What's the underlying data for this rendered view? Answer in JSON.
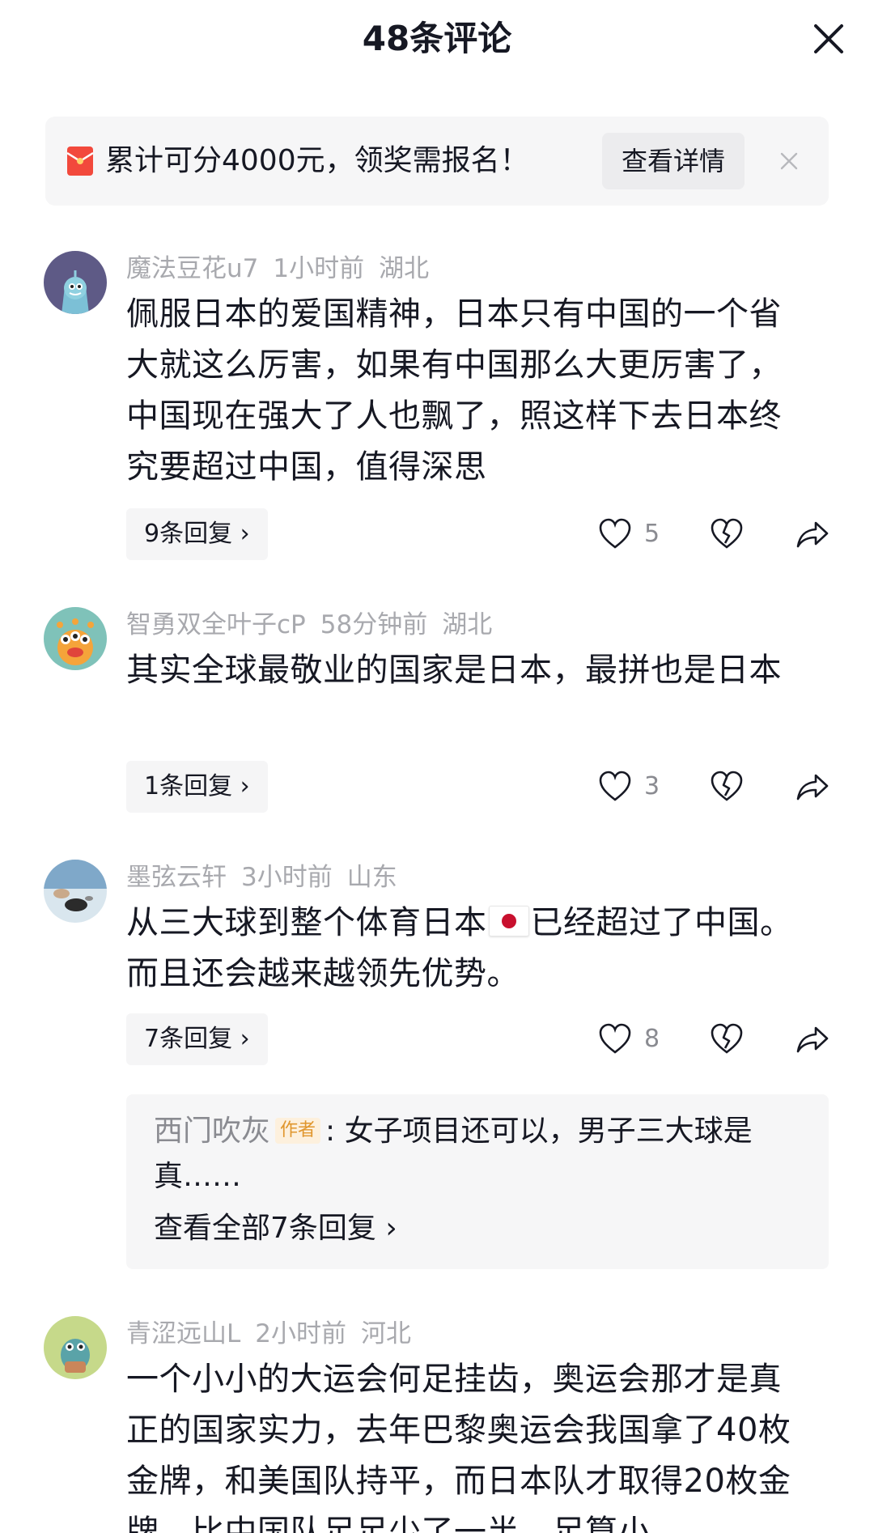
{
  "header": {
    "title": "48条评论"
  },
  "banner": {
    "text": "累计可分4000元，领奖需报名！",
    "detail_label": "查看详情"
  },
  "comments": [
    {
      "username": "魔法豆花u7",
      "time": "1小时前",
      "location": "湖北",
      "text": "佩服日本的爱国精神，日本只有中国的一个省大就这么厉害，如果有中国那么大更厉害了，中国现在强大了人也飘了，照这样下去日本终究要超过中国，值得深思",
      "replies_label": "9条回复 ›",
      "likes": "5"
    },
    {
      "username": "智勇双全叶子cP",
      "time": "58分钟前",
      "location": "湖北",
      "text": "其实全球最敬业的国家是日本，最拼也是日本",
      "replies_label": "1条回复 ›",
      "likes": "3"
    },
    {
      "username": "墨弦云轩",
      "time": "3小时前",
      "location": "山东",
      "text_before_flag": "从三大球到整个体育日本",
      "text_after_flag": "已经超过了中国。而且还会越来越领先优势。",
      "replies_label": "7条回复 ›",
      "likes": "8",
      "top_reply": {
        "author": "西门吹灰",
        "badge": "作者",
        "text": ": 女子项目还可以，男子三大球是真……",
        "view_all_label": "查看全部7条回复 ›"
      }
    },
    {
      "username": "青涩远山L",
      "time": "2小时前",
      "location": "河北",
      "text": "一个小小的大运会何足挂齿，奥运会那才是真正的国家实力，去年巴黎奥运会我国拿了40枚金牌，和美国队持平，而日本队才取得20枚金牌，比中国队足足少了一半，足算小"
    }
  ],
  "icons": {
    "close": "close-icon",
    "banner": "red-envelope-icon",
    "like": "heart-icon",
    "dislike": "broken-heart-icon",
    "share": "share-arrow-icon"
  },
  "colors": {
    "text_primary": "#161823",
    "text_secondary": "#a8a9ae",
    "accent_red": "#fe2c55",
    "badge_text": "#e0962d"
  }
}
